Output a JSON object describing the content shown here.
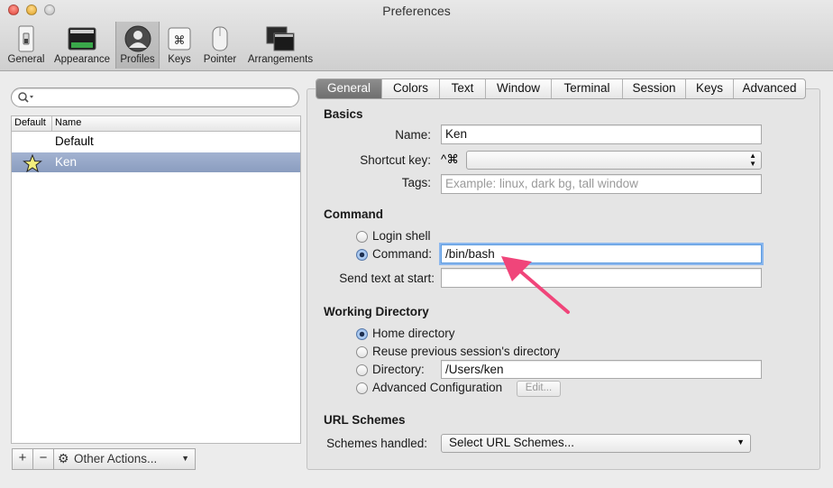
{
  "window": {
    "title": "Preferences"
  },
  "toolbar": {
    "items": [
      {
        "label": "General",
        "icon": "general-switch-icon"
      },
      {
        "label": "Appearance",
        "icon": "appearance-terminal-icon"
      },
      {
        "label": "Profiles",
        "icon": "profiles-person-icon",
        "selected": true
      },
      {
        "label": "Keys",
        "icon": "keys-command-icon"
      },
      {
        "label": "Pointer",
        "icon": "pointer-mouse-icon"
      },
      {
        "label": "Arrangements",
        "icon": "arrangements-windows-icon"
      }
    ]
  },
  "profiles": {
    "search_placeholder": "",
    "columns": {
      "default": "Default",
      "name": "Name"
    },
    "rows": [
      {
        "name": "Default",
        "is_default": false,
        "selected": false
      },
      {
        "name": "Ken",
        "is_default": true,
        "selected": true
      }
    ],
    "buttons": {
      "add": "+",
      "remove": "−",
      "other_actions": "Other Actions..."
    }
  },
  "tabs": [
    "General",
    "Colors",
    "Text",
    "Window",
    "Terminal",
    "Session",
    "Keys",
    "Advanced"
  ],
  "selected_tab": "General",
  "basics": {
    "heading": "Basics",
    "name_label": "Name:",
    "name_value": "Ken",
    "shortcut_label": "Shortcut key:",
    "shortcut_modifiers": "^⌘",
    "tags_label": "Tags:",
    "tags_placeholder": "Example: linux, dark bg, tall window"
  },
  "command": {
    "heading": "Command",
    "login_shell": "Login shell",
    "command_label": "Command:",
    "command_value": "/bin/bash",
    "send_text_label": "Send text at start:",
    "send_text_value": "",
    "selected": "command"
  },
  "working_directory": {
    "heading": "Working Directory",
    "home": "Home directory",
    "reuse": "Reuse previous session's directory",
    "directory_label": "Directory:",
    "directory_value": "/Users/ken",
    "advanced": "Advanced Configuration",
    "edit_button": "Edit...",
    "selected": "home"
  },
  "url_schemes": {
    "heading": "URL Schemes",
    "handled_label": "Schemes handled:",
    "select_value": "Select URL Schemes..."
  },
  "colors": {
    "annotation_arrow": "#f0457a",
    "focus_ring": "#5b9be0",
    "selected_row": "#8a9dbf"
  }
}
